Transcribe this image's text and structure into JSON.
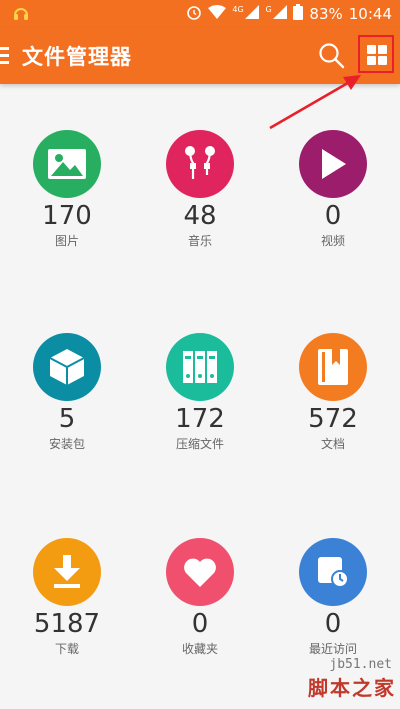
{
  "status": {
    "battery": "83%",
    "time": "10:44",
    "signal_4g": "4G",
    "signal_g": "G"
  },
  "app": {
    "title": "文件管理器",
    "colors": {
      "bar": "#f37021"
    }
  },
  "categories": [
    {
      "name": "images",
      "label": "图片",
      "count": "170",
      "icon": "image-icon",
      "color": "#27ae60"
    },
    {
      "name": "music",
      "label": "音乐",
      "count": "48",
      "icon": "earphones-icon",
      "color": "#e0245e"
    },
    {
      "name": "video",
      "label": "视频",
      "count": "0",
      "icon": "play-icon",
      "color": "#9c1d6b"
    },
    {
      "name": "apk",
      "label": "安装包",
      "count": "5",
      "icon": "package-icon",
      "color": "#0b8ea3"
    },
    {
      "name": "archive",
      "label": "压缩文件",
      "count": "172",
      "icon": "binders-icon",
      "color": "#1abc9c"
    },
    {
      "name": "docs",
      "label": "文档",
      "count": "572",
      "icon": "book-icon",
      "color": "#f47c20"
    },
    {
      "name": "downloads",
      "label": "下载",
      "count": "5187",
      "icon": "download-icon",
      "color": "#f39c12"
    },
    {
      "name": "favorites",
      "label": "收藏夹",
      "count": "0",
      "icon": "heart-icon",
      "color": "#f0506e"
    },
    {
      "name": "recent",
      "label": "最近访问",
      "count": "0",
      "icon": "recent-icon",
      "color": "#3b82d6"
    }
  ],
  "watermark": {
    "url": "jb51.net",
    "text": "脚本之家"
  }
}
